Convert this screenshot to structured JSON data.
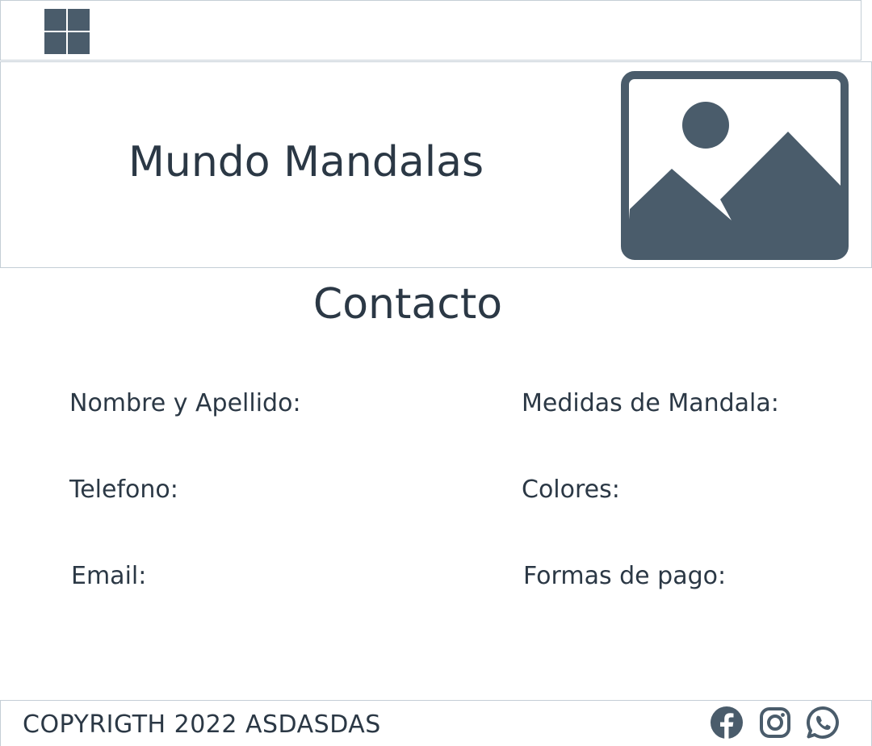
{
  "topbar": {
    "menu_icon": "grid-icon"
  },
  "header": {
    "title": "Mundo Mandalas",
    "image_icon": "image-placeholder-icon"
  },
  "contact": {
    "title": "Contacto",
    "left_fields": [
      {
        "label": "Nombre y Apellido:"
      },
      {
        "label": "Telefono:"
      },
      {
        "label": "Email:"
      }
    ],
    "right_fields": [
      {
        "label": "Medidas de Mandala:"
      },
      {
        "label": "Colores:"
      },
      {
        "label": "Formas de pago:"
      }
    ]
  },
  "footer": {
    "copyright": "COPYRIGTH 2022 ASDASDAS",
    "social_icons": [
      "facebook-icon",
      "instagram-icon",
      "whatsapp-icon"
    ]
  },
  "colors": {
    "text": "#2b3845",
    "icon": "#4a5c6b",
    "border": "#c4ced6",
    "background": "#ffffff"
  }
}
